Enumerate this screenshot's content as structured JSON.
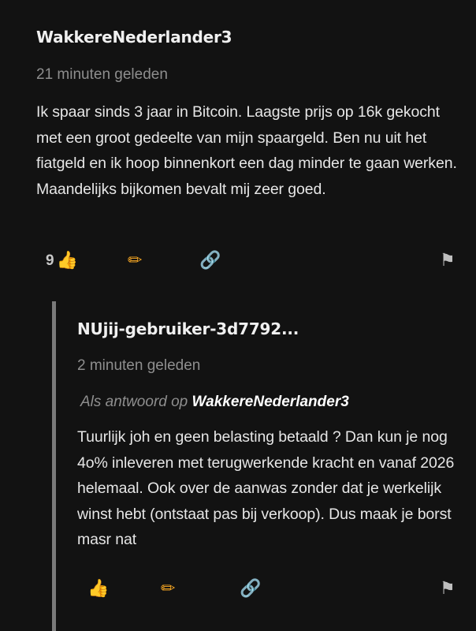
{
  "comments": [
    {
      "author": "WakkereNederlander3",
      "time": "21 minuten geleden",
      "body": "Ik spaar sinds 3 jaar in Bitcoin. Laagste prijs op 16k gekocht met een groot gedeelte van mijn spaargeld. Ben nu uit het fiatgeld en ik hoop binnenkort een dag minder te gaan werken. Maandelijks bijkomen bevalt mij zeer goed.",
      "likes": "9",
      "icons": {
        "like": "thumbs-up-icon",
        "edit": "pencil-icon",
        "link": "link-icon",
        "flag": "flag-icon"
      }
    },
    {
      "author": "NUjij-gebruiker-3d7792...",
      "time": "2 minuten geleden",
      "reply_prefix": "Als antwoord op",
      "reply_author": "WakkereNederlander3",
      "body": "Tuurlijk joh en geen belasting betaald ? Dan kun je nog 4o% inleveren met terugwerkende kracht en vanaf 2026 helemaal. Ook over de aanwas zonder dat je werkelijk winst hebt (ontstaat pas bij verkoop). Dus maak je borst masr nat",
      "likes": "",
      "icons": {
        "like": "thumbs-up-icon",
        "edit": "pencil-icon",
        "link": "link-icon",
        "flag": "flag-icon"
      }
    }
  ],
  "colors": {
    "background": "#121212",
    "text": "#e6e6e6",
    "muted": "#8e8e8e",
    "thread_line": "#7a7a7a",
    "accent_yellow": "#f2b637"
  }
}
